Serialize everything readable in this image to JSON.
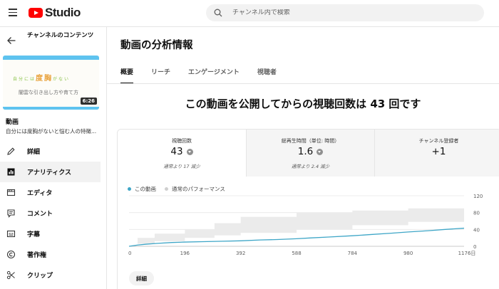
{
  "header": {
    "logo_text": "Studio",
    "search_placeholder": "チャンネル内で検索"
  },
  "sidebar": {
    "back_title": "チャンネルのコンテンツ",
    "thumbnail": {
      "line1_small": "自分には",
      "line1_big": "度胸",
      "line1_tail": "がない",
      "line2": "闇雲な引き出し方や育て方",
      "duration": "6:26"
    },
    "video_label": "動画",
    "video_description": "自分には度胸がないと悩む人の特徴...",
    "items": [
      {
        "label": "詳細",
        "icon": "pencil-icon",
        "active": false
      },
      {
        "label": "アナリティクス",
        "icon": "analytics-icon",
        "active": true
      },
      {
        "label": "エディタ",
        "icon": "film-icon",
        "active": false
      },
      {
        "label": "コメント",
        "icon": "comment-icon",
        "active": false
      },
      {
        "label": "字幕",
        "icon": "subtitles-icon",
        "active": false
      },
      {
        "label": "著作権",
        "icon": "copyright-icon",
        "active": false
      },
      {
        "label": "クリップ",
        "icon": "scissors-icon",
        "active": false
      }
    ]
  },
  "main": {
    "page_title": "動画の分析情報",
    "tabs": [
      {
        "label": "概要",
        "active": true
      },
      {
        "label": "リーチ",
        "active": false
      },
      {
        "label": "エンゲージメント",
        "active": false
      },
      {
        "label": "視聴者",
        "active": false
      }
    ],
    "headline": "この動画を公開してからの視聴回数は 43 回です",
    "metrics": [
      {
        "label": "視聴回数",
        "value": "43",
        "trend": "down",
        "note": "通常より 17 減少"
      },
      {
        "label": "総再生時間（単位: 時間）",
        "value": "1.6",
        "trend": "down",
        "note": "通常より 2.4 減少"
      },
      {
        "label": "チャンネル登録者",
        "value": "+1",
        "trend": "",
        "note": ""
      }
    ],
    "legend": {
      "this_video": "この動画",
      "typical": "通常のパフォーマンス"
    },
    "detail_button": "詳細"
  },
  "colors": {
    "series_line": "#3ea6c7",
    "band": "#ebebeb",
    "brand_red": "#ff0000"
  },
  "chart_data": {
    "type": "line",
    "x_ticks": [
      "0",
      "196",
      "392",
      "588",
      "784",
      "980",
      "1176日"
    ],
    "y_ticks": [
      "0",
      "40",
      "80",
      "120"
    ],
    "xlim": [
      0,
      1176
    ],
    "ylim": [
      0,
      120
    ],
    "series": [
      {
        "name": "この動画",
        "x": [
          0,
          30,
          60,
          100,
          150,
          196,
          260,
          330,
          392,
          460,
          520,
          588,
          640,
          700,
          784,
          850,
          920,
          980,
          1050,
          1110,
          1176
        ],
        "y": [
          0,
          3,
          5,
          7,
          9,
          10,
          11,
          12,
          13,
          15,
          16,
          18,
          20,
          22,
          25,
          28,
          31,
          34,
          37,
          40,
          43
        ]
      }
    ],
    "band": {
      "name": "通常のパフォーマンス",
      "x": [
        0,
        30,
        90,
        196,
        300,
        392,
        588,
        784,
        980,
        1176
      ],
      "low": [
        0,
        6,
        12,
        20,
        26,
        32,
        40,
        50,
        58,
        62
      ],
      "high": [
        0,
        20,
        30,
        40,
        55,
        70,
        80,
        85,
        90,
        95
      ]
    },
    "grid": true,
    "legend_position": "top-left"
  }
}
